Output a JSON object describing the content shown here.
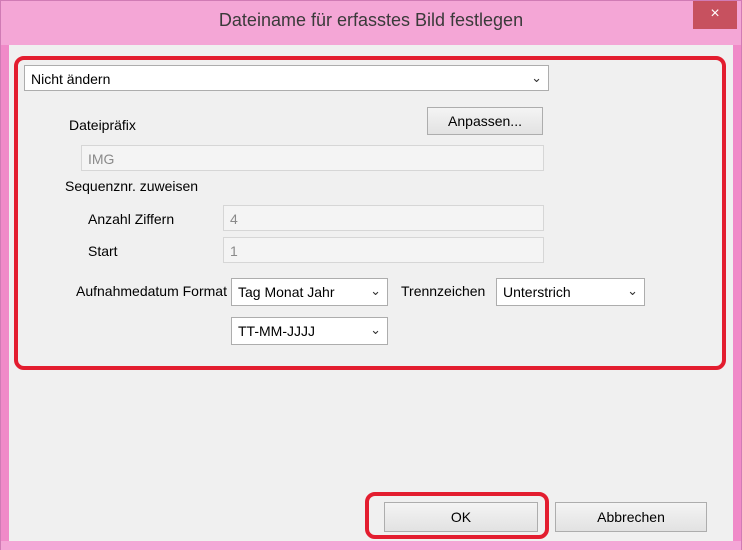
{
  "window": {
    "title": "Dateiname für erfasstes Bild festlegen",
    "close_glyph": "×"
  },
  "naming_mode": {
    "value": "Nicht ändern"
  },
  "prefix": {
    "label": "Dateipräfix",
    "customize_button": "Anpassen...",
    "value": "IMG"
  },
  "sequence": {
    "label": "Sequenznr. zuweisen",
    "digits_label": "Anzahl Ziffern",
    "digits_value": "4",
    "start_label": "Start",
    "start_value": "1"
  },
  "date_format": {
    "label": "Aufnahmedatum Format",
    "order_value": "Tag Monat Jahr",
    "separator_label": "Trennzeichen",
    "separator_value": "Unterstrich",
    "pattern_value": "TT-MM-JJJJ"
  },
  "buttons": {
    "ok": "OK",
    "cancel": "Abbrechen"
  },
  "icons": {
    "dropdown": "chevron-down-icon",
    "close": "close-icon"
  },
  "colors": {
    "highlight": "#e31d2f",
    "titlebar": "#f4a6d6",
    "close": "#c7515f"
  }
}
